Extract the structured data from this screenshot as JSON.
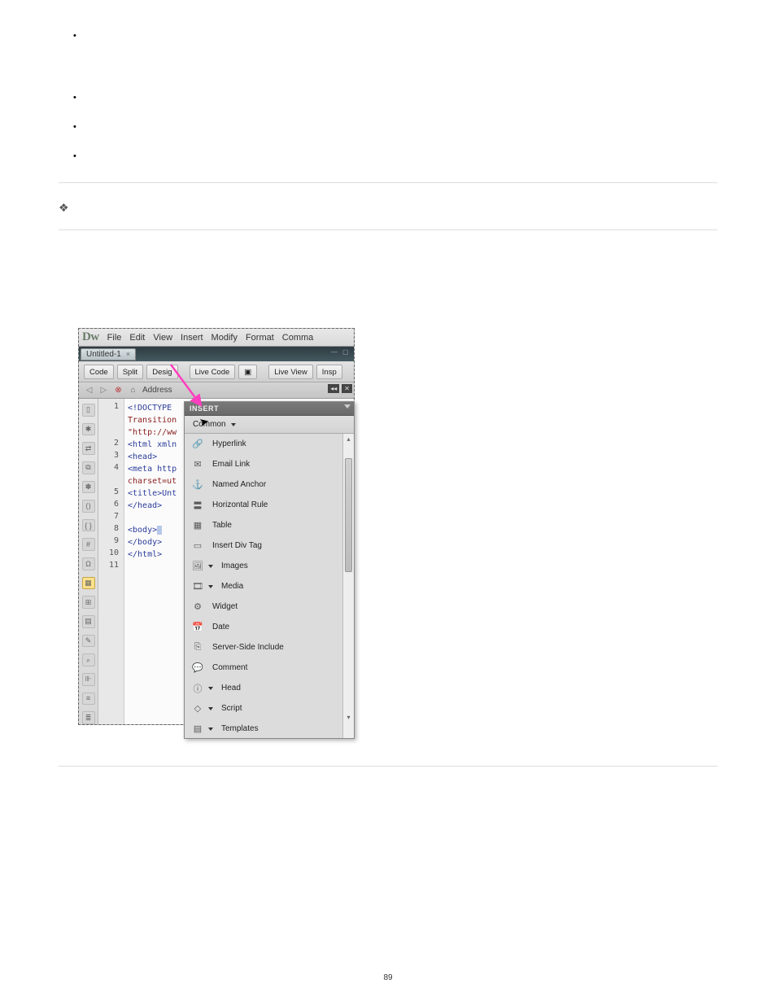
{
  "page_number": "89",
  "app_logo": "Dw",
  "menubar": [
    "File",
    "Edit",
    "View",
    "Insert",
    "Modify",
    "Format",
    "Comma"
  ],
  "document_tab": {
    "title": "Untitled-1",
    "close": "×"
  },
  "toolbar": {
    "code": "Code",
    "split": "Split",
    "design": "Desig",
    "livecode": "Live Code",
    "liveview": "Live View",
    "insp": "Insp"
  },
  "addressbar": {
    "label": "Address"
  },
  "code_gutter": [
    "1",
    "2",
    "3",
    "4",
    "5",
    "6",
    "7",
    "8",
    "9",
    "10",
    "11"
  ],
  "code_lines": [
    "<!DOCTYPE",
    "Transition",
    "\"http://ww",
    "<html xmln",
    "<head>",
    "<meta http",
    "charset=ut",
    "<title>Unt",
    "</head>",
    "",
    "<body>",
    "</body>",
    "</html>"
  ],
  "insert_panel": {
    "title": "INSERT",
    "category": "Common",
    "items": [
      {
        "label": "Hyperlink",
        "dropdown": false
      },
      {
        "label": "Email Link",
        "dropdown": false
      },
      {
        "label": "Named Anchor",
        "dropdown": false
      },
      {
        "label": "Horizontal Rule",
        "dropdown": false
      },
      {
        "label": "Table",
        "dropdown": false
      },
      {
        "label": "Insert Div Tag",
        "dropdown": false
      },
      {
        "label": "Images",
        "dropdown": true
      },
      {
        "label": "Media",
        "dropdown": true
      },
      {
        "label": "Widget",
        "dropdown": false
      },
      {
        "label": "Date",
        "dropdown": false
      },
      {
        "label": "Server-Side Include",
        "dropdown": false
      },
      {
        "label": "Comment",
        "dropdown": false
      },
      {
        "label": "Head",
        "dropdown": true
      },
      {
        "label": "Script",
        "dropdown": true
      },
      {
        "label": "Templates",
        "dropdown": true
      }
    ]
  }
}
